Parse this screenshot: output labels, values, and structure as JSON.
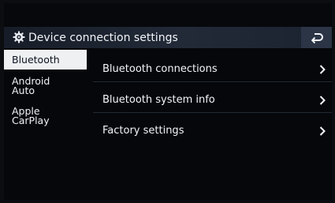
{
  "header": {
    "icon": "gear-icon",
    "title": "Device connection settings",
    "back_icon": "back-arrow-icon"
  },
  "sidebar": {
    "items": [
      {
        "lines": [
          "Bluetooth"
        ],
        "active": true
      },
      {
        "lines": [
          "Android",
          "Auto"
        ],
        "active": false
      },
      {
        "lines": [
          "Apple",
          "CarPlay"
        ],
        "active": false
      }
    ]
  },
  "menu": {
    "items": [
      {
        "label": "Bluetooth connections",
        "icon": "chevron-right-icon"
      },
      {
        "label": "Bluetooth system info",
        "icon": "chevron-right-icon"
      },
      {
        "label": "Factory settings",
        "icon": "chevron-right-icon"
      }
    ]
  },
  "colors": {
    "background": "#05070a",
    "header_bg": "#1e2634",
    "active_tab_bg": "#eef0f2",
    "active_tab_text": "#0d1420",
    "text": "#f3f5f8"
  }
}
